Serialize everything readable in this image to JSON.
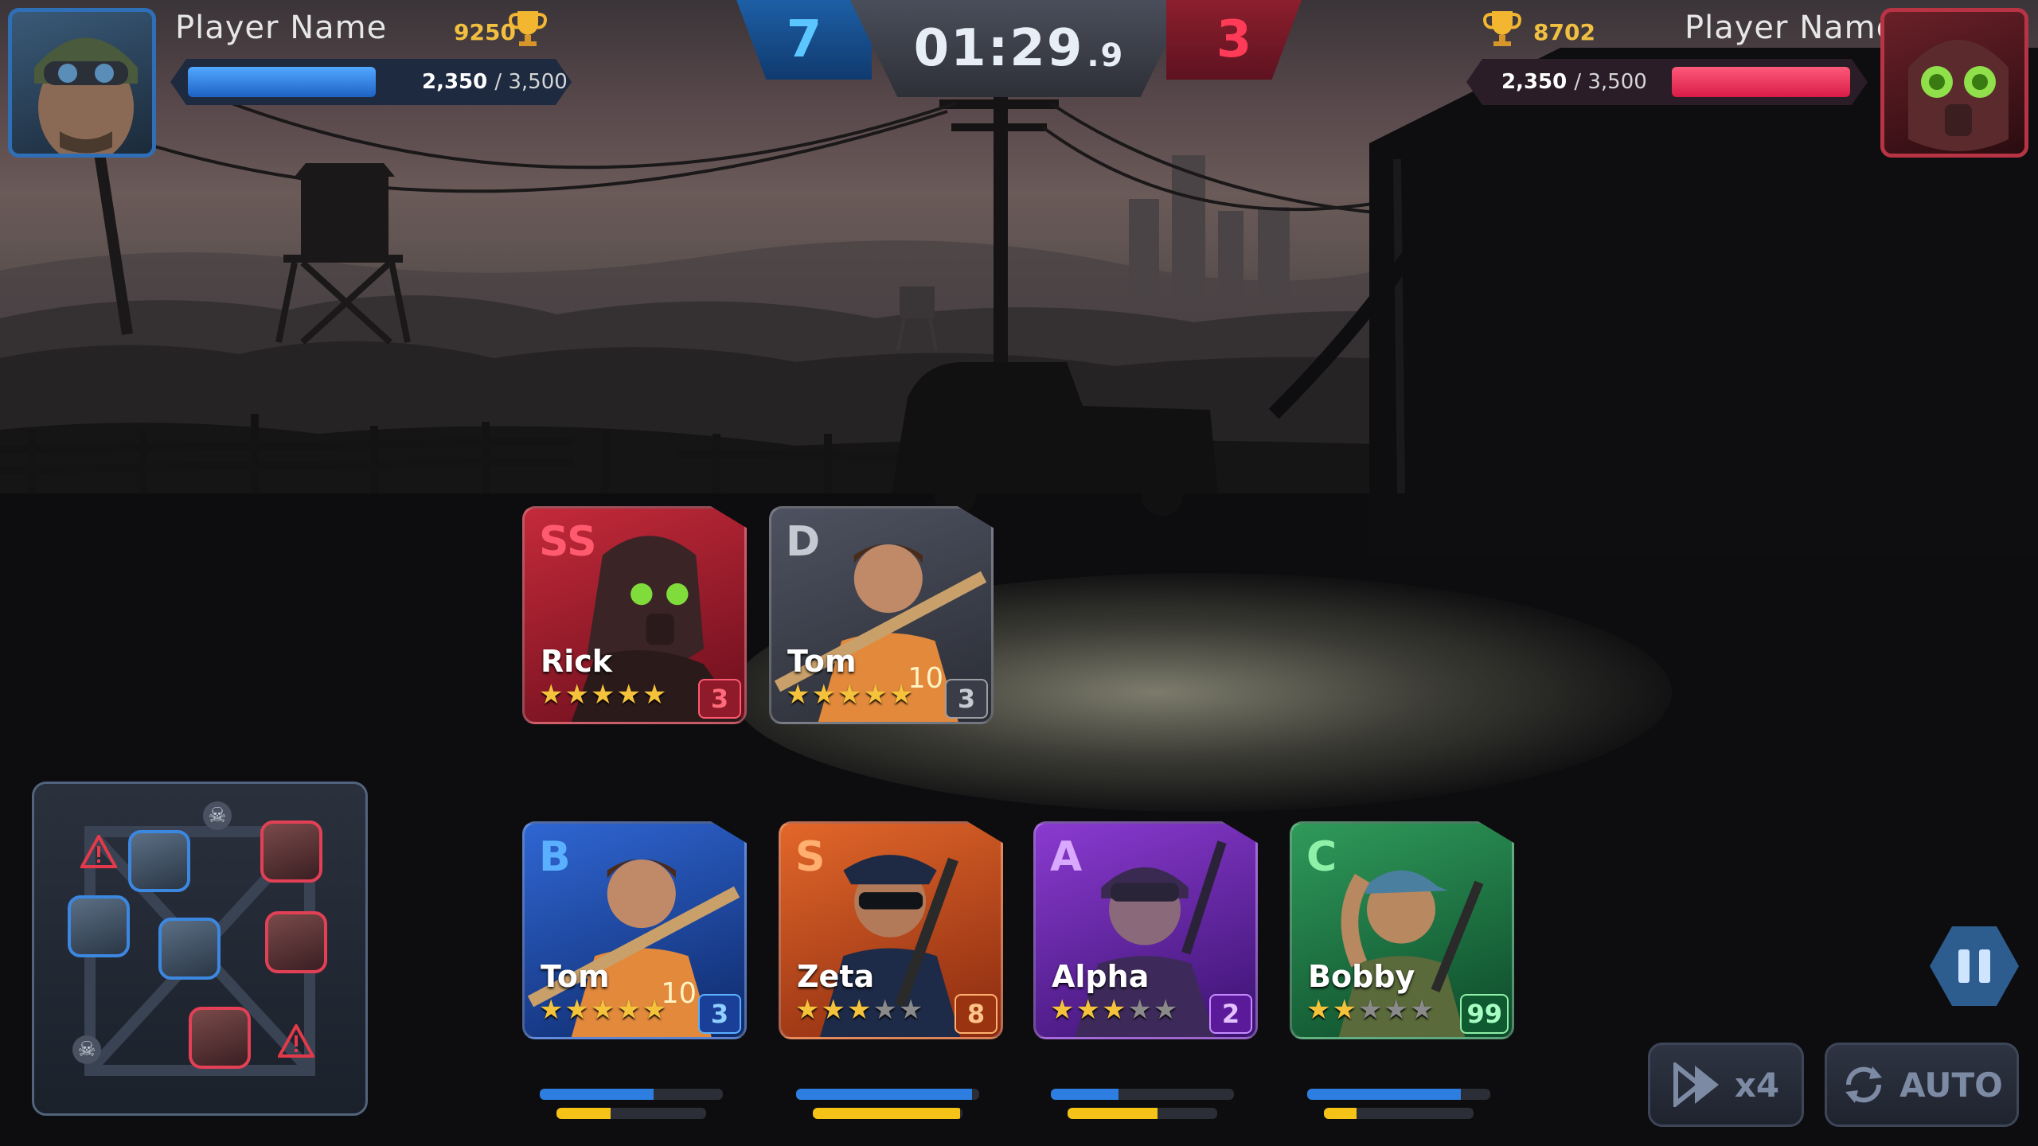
{
  "player_left": {
    "name": "Player Name",
    "trophies": "9250",
    "hp_current": "2,350",
    "hp_max": "3,500",
    "hp_fraction": 0.38
  },
  "player_right": {
    "name": "Player Name",
    "trophies": "8702",
    "hp_current": "2,350",
    "hp_max": "3,500",
    "hp_fraction": 0.38
  },
  "score": {
    "left": "7",
    "right": "3"
  },
  "timer": {
    "main": "01:29",
    "fraction": ".9"
  },
  "field_cards": [
    {
      "rank": "SS",
      "name": "Rick",
      "stars": 5,
      "max_stars": 5,
      "level": "3",
      "theme": "red"
    },
    {
      "rank": "D",
      "name": "Tom",
      "stars": 5,
      "max_stars": 5,
      "level": "3",
      "theme": "gray"
    }
  ],
  "hand_cards": [
    {
      "rank": "B",
      "name": "Tom",
      "stars": 5,
      "max_stars": 5,
      "level": "3",
      "theme": "blue",
      "blue_fill": 0.62,
      "yellow_fill": 0.22
    },
    {
      "rank": "S",
      "name": "Zeta",
      "stars": 3,
      "max_stars": 5,
      "level": "8",
      "theme": "orange",
      "blue_fill": 0.96,
      "yellow_fill": 0.98
    },
    {
      "rank": "A",
      "name": "Alpha",
      "stars": 3,
      "max_stars": 5,
      "level": "2",
      "theme": "purple",
      "blue_fill": 0.37,
      "yellow_fill": 0.6
    },
    {
      "rank": "C",
      "name": "Bobby",
      "stars": 2,
      "max_stars": 5,
      "level": "99",
      "theme": "green",
      "blue_fill": 0.84,
      "yellow_fill": 0.22
    }
  ],
  "controls": {
    "speed_label": "x4",
    "auto_label": "AUTO"
  },
  "colors": {
    "blue_team": "#2d7ee0",
    "red_team": "#ff3b57",
    "gold": "#f5c33b"
  }
}
